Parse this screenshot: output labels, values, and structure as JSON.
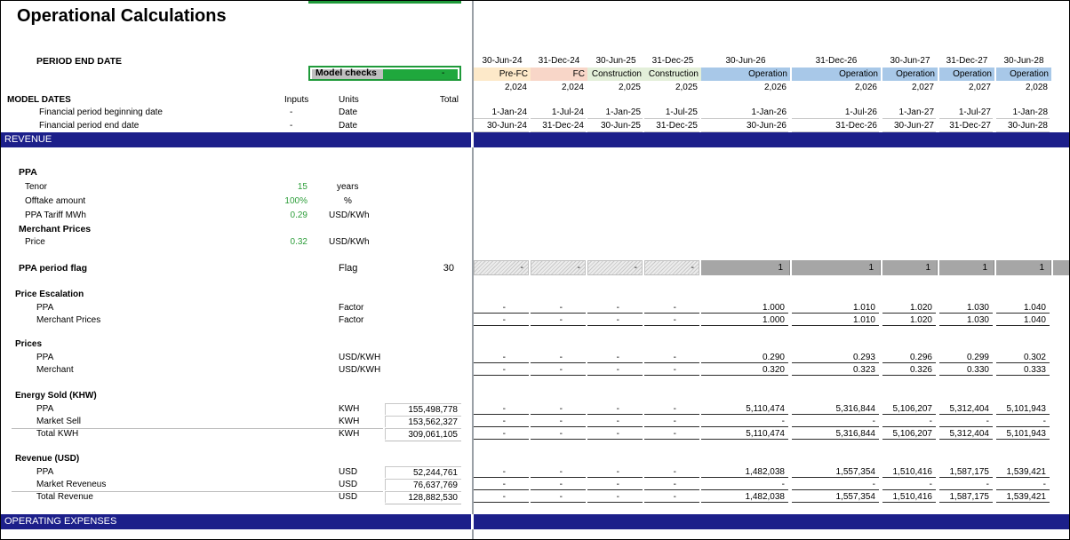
{
  "title": "Operational Calculations",
  "labels": {
    "period_end_date": "PERIOD END DATE",
    "model_checks": "Model checks",
    "model_checks_value": "-",
    "model_dates": "MODEL DATES",
    "inputs": "Inputs",
    "units": "Units",
    "total": "Total",
    "fin_begin": "Financial period beginning date",
    "fin_end": "Financial period end date",
    "dash": "-",
    "date_unit": "Date"
  },
  "columns": {
    "period_end": [
      "30-Jun-24",
      "31-Dec-24",
      "30-Jun-25",
      "31-Dec-25",
      "30-Jun-26",
      "31-Dec-26",
      "30-Jun-27",
      "31-Dec-27",
      "30-Jun-28"
    ],
    "phase": [
      "Pre-FC",
      "FC",
      "Construction",
      "Construction",
      "Operation",
      "Operation",
      "Operation",
      "Operation",
      "Operation"
    ],
    "year": [
      "2,024",
      "2,024",
      "2,025",
      "2,025",
      "2,026",
      "2,026",
      "2,027",
      "2,027",
      "2,028"
    ],
    "begin": [
      "1-Jan-24",
      "1-Jul-24",
      "1-Jan-25",
      "1-Jul-25",
      "1-Jan-26",
      "1-Jul-26",
      "1-Jan-27",
      "1-Jul-27",
      "1-Jan-28"
    ],
    "end": [
      "30-Jun-24",
      "31-Dec-24",
      "30-Jun-25",
      "31-Dec-25",
      "30-Jun-26",
      "31-Dec-26",
      "30-Jun-27",
      "31-Dec-27",
      "30-Jun-28"
    ]
  },
  "phase_colors": {
    "Pre-FC": "#fde9c9",
    "FC": "#f8d6c8",
    "Construction": "#e3efd9",
    "Operation": "#a8c8e8"
  },
  "sections": {
    "revenue": "REVENUE",
    "opex": "OPERATING EXPENSES"
  },
  "ppa": {
    "heading": "PPA",
    "tenor_label": "Tenor",
    "tenor_value": "15",
    "tenor_unit": "years",
    "offtake_label": "Offtake amount",
    "offtake_value": "100%",
    "offtake_unit": "%",
    "tariff_label": "PPA Tariff MWh",
    "tariff_value": "0.29",
    "tariff_unit": "USD/KWh"
  },
  "merchant": {
    "heading": "Merchant Prices",
    "price_label": "Price",
    "price_value": "0.32",
    "price_unit": "USD/KWh"
  },
  "flag": {
    "label": "PPA period flag",
    "unit": "Flag",
    "total": "30",
    "values": [
      "-",
      "-",
      "-",
      "-",
      "1",
      "1",
      "1",
      "1",
      "1"
    ]
  },
  "blocks": [
    {
      "heading": "Price Escalation",
      "rows": [
        {
          "label": "PPA",
          "unit": "Factor",
          "total": "",
          "values": [
            "-",
            "-",
            "-",
            "-",
            "1.000",
            "1.010",
            "1.020",
            "1.030",
            "1.040"
          ]
        },
        {
          "label": "Merchant Prices",
          "unit": "Factor",
          "total": "",
          "values": [
            "-",
            "-",
            "-",
            "-",
            "1.000",
            "1.010",
            "1.020",
            "1.030",
            "1.040"
          ]
        }
      ]
    },
    {
      "heading": "Prices",
      "rows": [
        {
          "label": "PPA",
          "unit": "USD/KWH",
          "total": "",
          "values": [
            "-",
            "-",
            "-",
            "-",
            "0.290",
            "0.293",
            "0.296",
            "0.299",
            "0.302"
          ]
        },
        {
          "label": "Merchant",
          "unit": "USD/KWH",
          "total": "",
          "values": [
            "-",
            "-",
            "-",
            "-",
            "0.320",
            "0.323",
            "0.326",
            "0.330",
            "0.333"
          ]
        }
      ]
    },
    {
      "heading": "Energy Sold (KHW)",
      "rows": [
        {
          "label": "PPA",
          "unit": "KWH",
          "total": "155,498,778",
          "values": [
            "-",
            "-",
            "-",
            "-",
            "5,110,474",
            "5,316,844",
            "5,106,207",
            "5,312,404",
            "5,101,943"
          ]
        },
        {
          "label": "Market Sell",
          "unit": "KWH",
          "total": "153,562,327",
          "values": [
            "-",
            "-",
            "-",
            "-",
            "-",
            "-",
            "-",
            "-",
            "-"
          ]
        },
        {
          "label": "Total KWH",
          "unit": "KWH",
          "total": "309,061,105",
          "values": [
            "-",
            "-",
            "-",
            "-",
            "5,110,474",
            "5,316,844",
            "5,106,207",
            "5,312,404",
            "5,101,943"
          ]
        }
      ]
    },
    {
      "heading": "Revenue (USD)",
      "rows": [
        {
          "label": "PPA",
          "unit": "USD",
          "total": "52,244,761",
          "values": [
            "-",
            "-",
            "-",
            "-",
            "1,482,038",
            "1,557,354",
            "1,510,416",
            "1,587,175",
            "1,539,421"
          ]
        },
        {
          "label": "Market Reveneus",
          "unit": "USD",
          "total": "76,637,769",
          "values": [
            "-",
            "-",
            "-",
            "-",
            "-",
            "-",
            "-",
            "-",
            "-"
          ]
        },
        {
          "label": "Total Revenue",
          "unit": "USD",
          "total": "128,882,530",
          "values": [
            "-",
            "-",
            "-",
            "-",
            "1,482,038",
            "1,557,354",
            "1,510,416",
            "1,587,175",
            "1,539,421"
          ]
        }
      ]
    }
  ]
}
